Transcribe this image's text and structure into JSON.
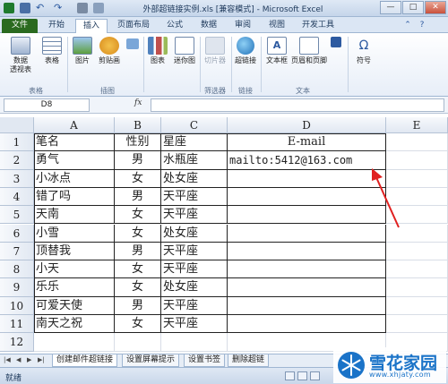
{
  "window": {
    "title": "外部超链接实例.xls  [兼容模式] - Microsoft Excel",
    "minimize": "—",
    "restore": "□",
    "close": "✕"
  },
  "tabs": [
    "文件",
    "开始",
    "插入",
    "页面布局",
    "公式",
    "数据",
    "审阅",
    "视图",
    "开发工具"
  ],
  "active_tab": "插入",
  "ribbon": {
    "buttons": {
      "pivot": "数据\n透视表",
      "table": "表格",
      "picture": "图片",
      "clipart": "剪贴画",
      "chart": "图表",
      "sparkline": "迷你图",
      "slicer": "切片器",
      "hyperlink": "超链接",
      "textbox": "文本框",
      "headerfooter": "页眉和页脚",
      "symbol": "符号"
    },
    "groups": {
      "tables": "表格",
      "illustrations": "插图",
      "filter": "筛选器",
      "links": "链接",
      "text": "文本"
    }
  },
  "formula_bar": {
    "name_box": "D8",
    "fx": "fx",
    "value": ""
  },
  "columns": [
    "A",
    "B",
    "C",
    "D",
    "E"
  ],
  "rows": [
    "1",
    "2",
    "3",
    "4",
    "5",
    "6",
    "7",
    "8",
    "9",
    "10",
    "11",
    "12"
  ],
  "table": {
    "header": [
      "笔名",
      "性别",
      "星座",
      "E-mail"
    ],
    "data": [
      [
        "勇气",
        "男",
        "水瓶座",
        "mailto:5412@163.com"
      ],
      [
        "小冰点",
        "女",
        "处女座",
        ""
      ],
      [
        "错了吗",
        "男",
        "天平座",
        ""
      ],
      [
        "天南",
        "女",
        "天平座",
        ""
      ],
      [
        "小雪",
        "女",
        "处女座",
        ""
      ],
      [
        "顶替我",
        "男",
        "天平座",
        ""
      ],
      [
        "小天",
        "女",
        "天平座",
        ""
      ],
      [
        "乐乐",
        "女",
        "处女座",
        ""
      ],
      [
        "可爱天使",
        "男",
        "天平座",
        ""
      ],
      [
        "南天之祝",
        "女",
        "天平座",
        ""
      ]
    ]
  },
  "sheet_tabs": [
    "创建邮件超链接",
    "设置屏幕提示",
    "设置书签",
    "删除超链"
  ],
  "status": {
    "ready": "就绪"
  },
  "watermark": {
    "cn": "雪花家园",
    "en": "www.xhjaty.com"
  },
  "colors": {
    "annotation_arrow": "#e02020",
    "file_tab": "#2a6a1f",
    "watermark": "#1a73c8"
  }
}
